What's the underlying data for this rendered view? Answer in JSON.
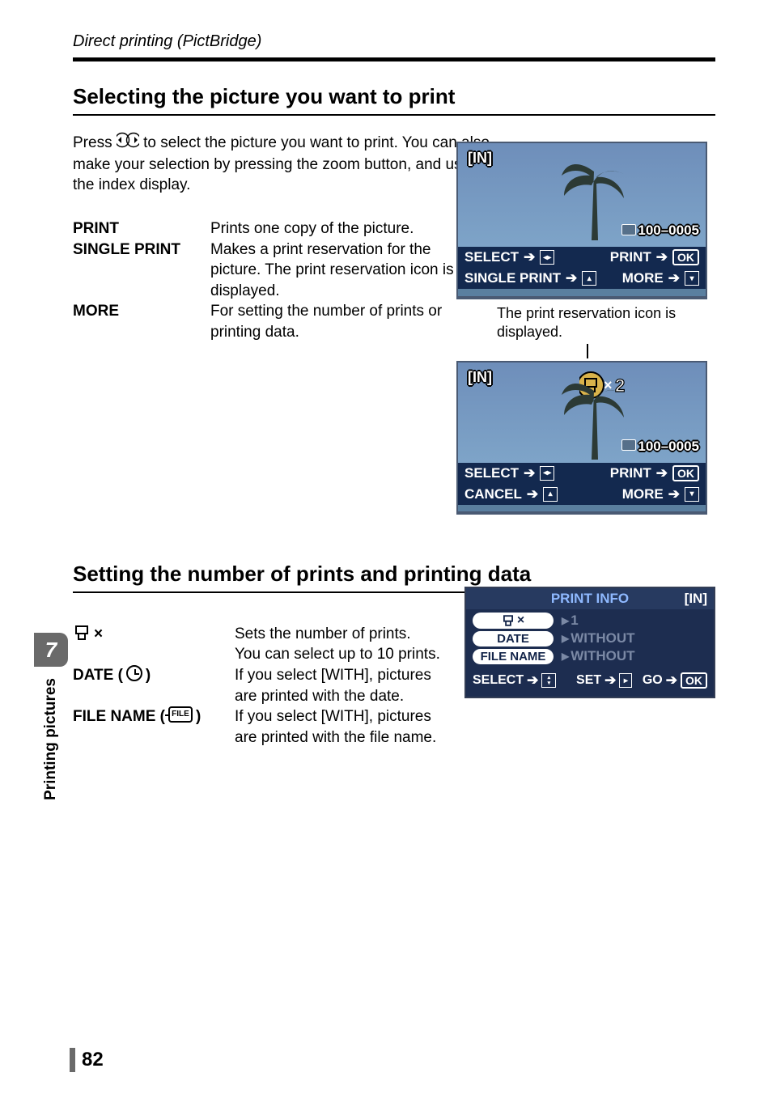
{
  "header": {
    "path": "Direct printing (PictBridge)"
  },
  "section1": {
    "title": "Selecting the picture you want to print",
    "intro_before_icon": "Press ",
    "intro_after_icon": " to select the picture you want to print. You can also make your selection by pressing the zoom button, and using the index display.",
    "terms": [
      {
        "term": "PRINT",
        "desc": "Prints one copy of the picture."
      },
      {
        "term": "SINGLE PRINT",
        "desc": "Makes a print reservation for the picture. The print reservation icon is displayed."
      },
      {
        "term": "MORE",
        "desc": "For setting the number of prints or printing data."
      }
    ]
  },
  "lcd1": {
    "in": "[IN]",
    "file": "100–0005",
    "row1_left": "SELECT",
    "row1_right": "PRINT",
    "row1_right_key": "OK",
    "row2_left": "SINGLE PRINT",
    "row2_right": "MORE"
  },
  "note": "The print reservation icon is displayed.",
  "lcd2": {
    "in": "[IN]",
    "badge_value": "2",
    "file": "100–0005",
    "row1_left": "SELECT",
    "row1_right": "PRINT",
    "row1_right_key": "OK",
    "row2_left": "CANCEL",
    "row2_right": "MORE"
  },
  "section2": {
    "title": "Setting the number of prints and printing data",
    "terms": [
      {
        "term_suffix": "×",
        "desc": "Sets the number of prints. You can select up to 10 prints."
      },
      {
        "term": "DATE (",
        "term_close": " )",
        "desc": "If you select [WITH], pictures are printed with the date."
      },
      {
        "term": "FILE NAME (",
        "term_close": " )",
        "term_icon_text": "FILE",
        "desc": "If you select [WITH], pictures are printed with the file name."
      }
    ]
  },
  "print_info": {
    "header": "PRINT INFO",
    "in": "[IN]",
    "rows": [
      {
        "label_icon": "print-x",
        "val": "1"
      },
      {
        "label": "DATE",
        "val": "WITHOUT"
      },
      {
        "label": "FILE NAME",
        "val": "WITHOUT"
      }
    ],
    "footer": {
      "select": "SELECT",
      "set": "SET",
      "go": "GO",
      "ok": "OK"
    }
  },
  "side": {
    "chapter": "7",
    "label": "Printing pictures"
  },
  "page_number": "82"
}
